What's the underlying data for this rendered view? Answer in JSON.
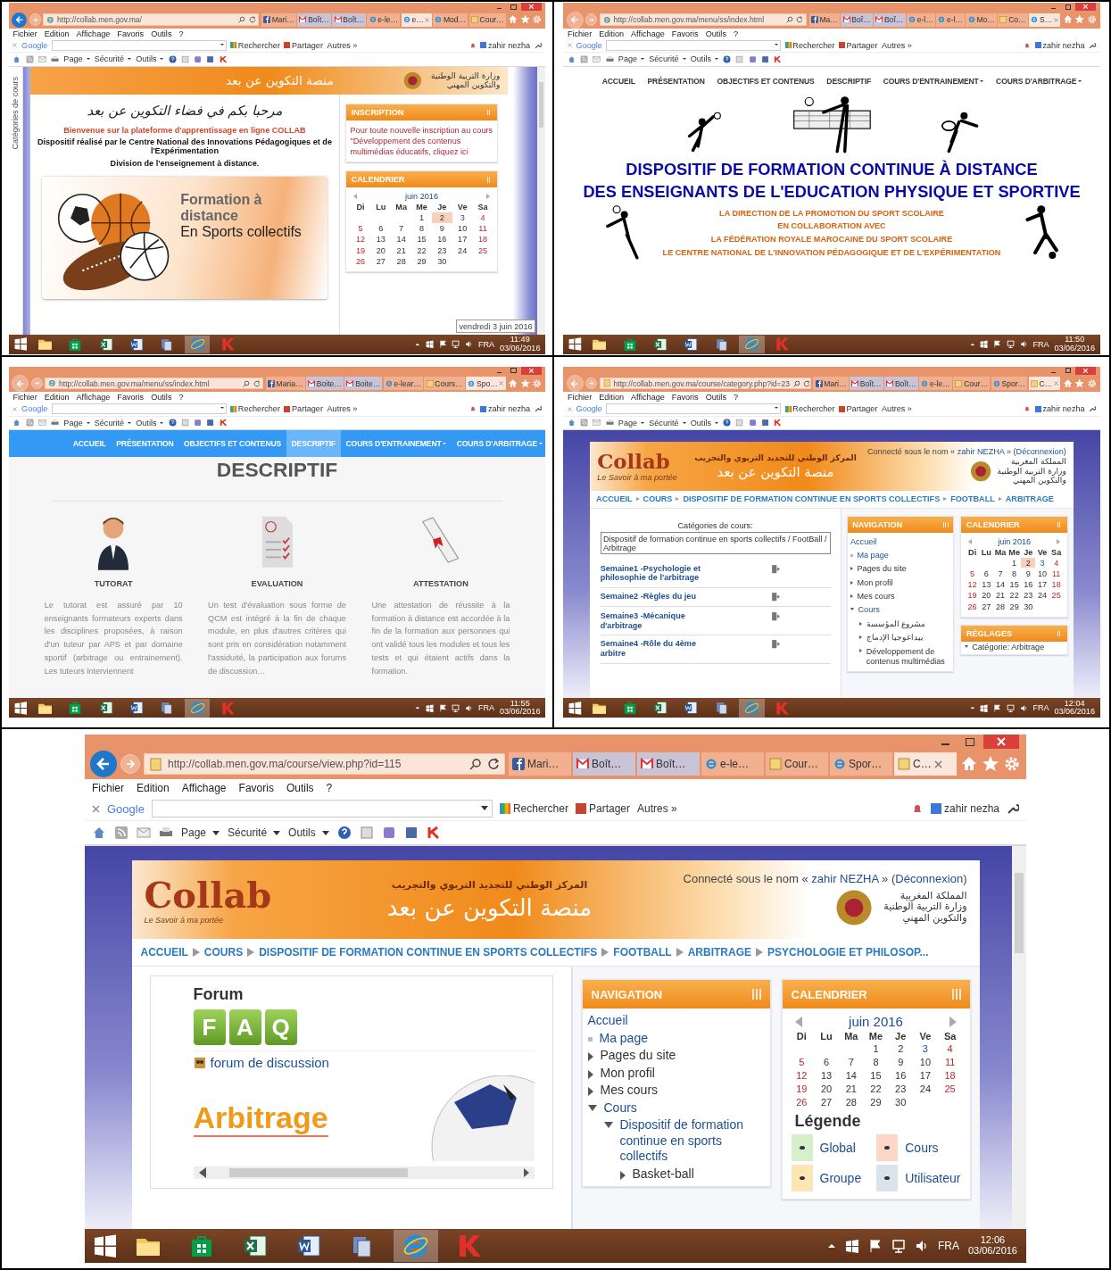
{
  "panels": [
    {
      "browser": {
        "back_enabled": true,
        "url": "http://collab.men.gov.ma/",
        "tabs": [
          {
            "label": "Mari…",
            "kind": "facebook",
            "selected": false
          },
          {
            "label": "Boît…",
            "kind": "mail",
            "selected": false
          },
          {
            "label": "Boît…",
            "kind": "mail",
            "selected": false
          },
          {
            "label": "e-le…",
            "kind": "browser",
            "selected": false
          },
          {
            "label": "e…",
            "kind": "browser",
            "selected": true
          },
          {
            "label": "Mod…",
            "kind": "browser",
            "selected": false
          },
          {
            "label": "Cour…",
            "kind": "course",
            "selected": false
          }
        ],
        "menu": [
          "Fichier",
          "Edition",
          "Affichage",
          "Favoris",
          "Outils",
          "?"
        ],
        "google_bar": {
          "brand": "Google",
          "search": "Rechercher",
          "share": "Partager",
          "more": "Autres »",
          "user": "zahir nezha"
        },
        "commands": [
          "Page",
          "Sécurité",
          "Outils"
        ]
      },
      "content": {
        "kind": "welcome",
        "header": {
          "title_ar": "منصة التكوين عن بعد",
          "ministry_ar": [
            "وزارة التربية الوطنية",
            "والتكوين المهني"
          ]
        },
        "side_tab": "Catégories de cours",
        "welcome_ar": "مرحبا بكم في فضاء التكوين عن بعد",
        "welcome_fr": "Bienvenue sur la plateforme d'apprentissage en ligne COLLAB",
        "credits": [
          "Dispositif réalisé par le Centre National des Innovations Pédagogiques et de l'Expérimentation",
          "Division de l'enseignement à distance."
        ],
        "banner": [
          "Formation à distance",
          "En Sports collectifs"
        ],
        "side_columns": [
          [
            {
              "kind": "text",
              "title": "INSCRIPTION",
              "text": "Pour toute nouvelle inscription au cours \"Développement des contenus multimédias éducatifs, cliquez ici"
            },
            {
              "kind": "calendar",
              "title": "CALENDRIER",
              "month": "juin 2016",
              "weekdays": [
                "Di",
                "Lu",
                "Ma",
                "Me",
                "Je",
                "Ve",
                "Sa"
              ],
              "weeks": [
                [
                  {
                    "kind": "blank"
                  },
                  {
                    "kind": "blank"
                  },
                  {
                    "kind": "blank"
                  },
                  {
                    "kind": "day",
                    "day": "1"
                  },
                  {
                    "kind": "today",
                    "day": "2"
                  },
                  {
                    "kind": "event",
                    "day": "3"
                  },
                  {
                    "kind": "day",
                    "day": "4"
                  }
                ],
                [
                  {
                    "kind": "day",
                    "day": "5"
                  },
                  {
                    "kind": "day",
                    "day": "6"
                  },
                  {
                    "kind": "day",
                    "day": "7"
                  },
                  {
                    "kind": "day",
                    "day": "8"
                  },
                  {
                    "kind": "day",
                    "day": "9"
                  },
                  {
                    "kind": "day",
                    "day": "10"
                  },
                  {
                    "kind": "day",
                    "day": "11"
                  }
                ],
                [
                  {
                    "kind": "day",
                    "day": "12"
                  },
                  {
                    "kind": "day",
                    "day": "13"
                  },
                  {
                    "kind": "day",
                    "day": "14"
                  },
                  {
                    "kind": "day",
                    "day": "15"
                  },
                  {
                    "kind": "day",
                    "day": "16"
                  },
                  {
                    "kind": "day",
                    "day": "17"
                  },
                  {
                    "kind": "day",
                    "day": "18"
                  }
                ],
                [
                  {
                    "kind": "day",
                    "day": "19"
                  },
                  {
                    "kind": "day",
                    "day": "20"
                  },
                  {
                    "kind": "day",
                    "day": "21"
                  },
                  {
                    "kind": "day",
                    "day": "22"
                  },
                  {
                    "kind": "day",
                    "day": "23"
                  },
                  {
                    "kind": "day",
                    "day": "24"
                  },
                  {
                    "kind": "day",
                    "day": "25"
                  }
                ],
                [
                  {
                    "kind": "day",
                    "day": "26"
                  },
                  {
                    "kind": "day",
                    "day": "27"
                  },
                  {
                    "kind": "day",
                    "day": "28"
                  },
                  {
                    "kind": "day",
                    "day": "29"
                  },
                  {
                    "kind": "day",
                    "day": "30"
                  }
                ]
              ]
            }
          ]
        ],
        "tooltip": "vendredi 3 juin 2016"
      },
      "taskbar": {
        "apps": [
          {
            "kind": "folder",
            "active": false
          },
          {
            "kind": "store",
            "active": false
          },
          {
            "kind": "sheet",
            "active": false
          },
          {
            "kind": "document",
            "active": false
          },
          {
            "kind": "files",
            "active": false
          },
          {
            "kind": "browser",
            "active": true
          },
          {
            "kind": "shield",
            "active": false
          }
        ],
        "lang": "FRA",
        "time": "11:49",
        "date": "03/06/2016"
      }
    },
    {
      "browser": {
        "back_enabled": false,
        "url": "http://collab.men.gov.ma/menu/ss/index.html",
        "tabs": [
          {
            "label": "Ma…",
            "kind": "facebook",
            "selected": false
          },
          {
            "label": "Boî…",
            "kind": "mail",
            "selected": false
          },
          {
            "label": "Boî…",
            "kind": "mail",
            "selected": false
          },
          {
            "label": "e-l…",
            "kind": "browser",
            "selected": false
          },
          {
            "label": "e-l…",
            "kind": "browser",
            "selected": false
          },
          {
            "label": "Mo…",
            "kind": "browser",
            "selected": false
          },
          {
            "label": "Co…",
            "kind": "course",
            "selected": false
          },
          {
            "label": "S…",
            "kind": "browser",
            "selected": true
          }
        ],
        "menu": [
          "Fichier",
          "Edition",
          "Affichage",
          "Favoris",
          "Outils",
          "?"
        ],
        "google_bar": {
          "brand": "Google",
          "search": "Rechercher",
          "share": "Partager",
          "more": "Autres »",
          "user": "zahir nezha"
        },
        "commands": [
          "Page",
          "Sécurité",
          "Outils"
        ]
      },
      "content": {
        "kind": "sports_home",
        "nav": [
          {
            "label": "ACCUEIL",
            "dropdown": false,
            "selected": false
          },
          {
            "label": "PRÉSENTATION",
            "dropdown": false,
            "selected": false
          },
          {
            "label": "OBJECTIFS ET CONTENUS",
            "dropdown": false,
            "selected": false
          },
          {
            "label": "DESCRIPTIF",
            "dropdown": false,
            "selected": false
          },
          {
            "label": "COURS D'ENTRAINEMENT",
            "dropdown": true,
            "selected": false
          },
          {
            "label": "COURS D'ARBITRAGE",
            "dropdown": true,
            "selected": false
          }
        ],
        "titles": [
          "DISPOSITIF DE FORMATION CONTINUE À DISTANCE",
          "DES ENSEIGNANTS DE L'EDUCATION PHYSIQUE ET SPORTIVE"
        ],
        "partners": [
          "LA DIRECTION DE LA PROMOTION DU SPORT SCOLAIRE",
          "EN COLLABORATION AVEC",
          "LA FÉDÉRATION ROYALE MAROCAINE DU SPORT SCOLAIRE",
          "LE CENTRE NATIONAL DE L'INNOVATION PÉDAGOGIQUE ET DE L'EXPÉRIMENTATION"
        ]
      },
      "taskbar": {
        "apps": [
          {
            "kind": "folder",
            "active": false
          },
          {
            "kind": "store",
            "active": false
          },
          {
            "kind": "sheet",
            "active": false
          },
          {
            "kind": "document",
            "active": false
          },
          {
            "kind": "files",
            "active": false
          },
          {
            "kind": "browser",
            "active": true
          },
          {
            "kind": "shield",
            "active": false
          }
        ],
        "lang": "FRA",
        "time": "11:50",
        "date": "03/06/2016"
      }
    },
    {
      "browser": {
        "back_enabled": false,
        "url": "http://collab.men.gov.ma/menu/ss/index.html",
        "tabs": [
          {
            "label": "Maria…",
            "kind": "facebook",
            "selected": false
          },
          {
            "label": "Boite…",
            "kind": "mail",
            "selected": false
          },
          {
            "label": "Boite…",
            "kind": "mail",
            "selected": false
          },
          {
            "label": "e-lear…",
            "kind": "browser",
            "selected": false
          },
          {
            "label": "Cours…",
            "kind": "course",
            "selected": false
          },
          {
            "label": "Spo…",
            "kind": "browser",
            "selected": true
          }
        ],
        "menu": [
          "Fichier",
          "Edition",
          "Affichage",
          "Favoris",
          "Outils",
          "?"
        ],
        "google_bar": {
          "brand": "Google",
          "search": "Rechercher",
          "share": "Partager",
          "more": "Autres »",
          "user": "zahir nezha"
        },
        "commands": [
          "Page",
          "Sécurité",
          "Outils"
        ]
      },
      "content": {
        "kind": "descriptif",
        "nav": [
          {
            "label": "ACCUEIL",
            "dropdown": false,
            "selected": false
          },
          {
            "label": "PRÉSENTATION",
            "dropdown": false,
            "selected": false
          },
          {
            "label": "OBJECTIFS ET CONTENUS",
            "dropdown": false,
            "selected": false
          },
          {
            "label": "DESCRIPTIF",
            "dropdown": false,
            "selected": true
          },
          {
            "label": "COURS D'ENTRAINEMENT",
            "dropdown": true,
            "selected": false
          },
          {
            "label": "COURS D'ARBITRAGE",
            "dropdown": true,
            "selected": false
          }
        ],
        "heading": "DESCRIPTIF",
        "features": [
          {
            "kind": "person",
            "title": "TUTORAT",
            "text": "Le tutorat est assuré par 10 enseignants formateurs experts dans les disciplines proposées, à raison d'un tuteur par APS et par domaine sportif (arbitrage ou entrainement). Les tuteurs interviennent"
          },
          {
            "kind": "checklist",
            "title": "EVALUATION",
            "text": "Un test d'évaluation sous forme de QCM est intégré à la fin de chaque module, en plus d'autres critères qui sont pris en considération notamment l'assiduité, la participation aux forums de discussion…"
          },
          {
            "kind": "diploma",
            "title": "ATTESTATION",
            "text": "Une attestation de réussite à la formation à distance est accordée à la fin de la formation aux personnes qui ont validé tous les modules et tous les tests et qui étaient actifs dans la formation."
          }
        ]
      },
      "taskbar": {
        "apps": [
          {
            "kind": "folder",
            "active": false
          },
          {
            "kind": "store",
            "active": false
          },
          {
            "kind": "sheet",
            "active": false
          },
          {
            "kind": "document",
            "active": false
          },
          {
            "kind": "files",
            "active": false
          },
          {
            "kind": "browser",
            "active": true
          },
          {
            "kind": "shield",
            "active": false
          }
        ],
        "lang": "FRA",
        "time": "11:55",
        "date": "03/06/2016"
      }
    },
    {
      "browser": {
        "back_enabled": false,
        "url": "http://collab.men.gov.ma/course/category.php?id=23",
        "tabs": [
          {
            "label": "Mari…",
            "kind": "facebook",
            "selected": false
          },
          {
            "label": "Boît…",
            "kind": "mail",
            "selected": false
          },
          {
            "label": "Boît…",
            "kind": "mail",
            "selected": false
          },
          {
            "label": "e-le…",
            "kind": "browser",
            "selected": false
          },
          {
            "label": "Cour…",
            "kind": "course",
            "selected": false
          },
          {
            "label": "Spor…",
            "kind": "browser",
            "selected": false
          },
          {
            "label": "C…",
            "kind": "course",
            "selected": true
          }
        ],
        "menu": [
          "Fichier",
          "Edition",
          "Affichage",
          "Favoris",
          "Outils",
          "?"
        ],
        "google_bar": {
          "brand": "Google",
          "search": "Rechercher",
          "share": "Partager",
          "more": "Autres »",
          "user": "zahir nezha"
        },
        "commands": [
          "Page",
          "Sécurité",
          "Outils"
        ]
      },
      "content": {
        "kind": "category",
        "header": {
          "logo": "Collab",
          "slogan": "Le Savoir à ma portée",
          "centre_ar": "المركز الوطني للتجديد التربوي والتجريب",
          "title_ar": "منصة التكوين عن بعد",
          "ministry_ar": [
            "المملكة المغربية",
            "وزارة التربية الوطنية",
            "والتكوين المهني"
          ],
          "login": {
            "prefix": "Connecté sous le nom «",
            "user": "zahir NEZHA",
            "middle": "» (",
            "logout": "Déconnexion",
            "suffix": ")"
          }
        },
        "breadcrumb": [
          "ACCUEIL",
          "COURS",
          "DISPOSITIF DE FORMATION CONTINUE EN SPORTS COLLECTIFS",
          "FOOTBALL",
          "ARBITRAGE"
        ],
        "categories_label": "Catégories de cours:",
        "category_value": "Dispositif de formation continue en sports collectifs / FootBall / Arbitrage",
        "weeks": [
          "Semaine1 -Psychologie et philosophie de l'arbitrage",
          "Semaine2 -Règles du jeu",
          "Semaine3 -Mécanique d'arbitrage",
          "Semaine4 -Rôle du 4ème arbitre"
        ],
        "side_columns": [
          [
            {
              "kind": "navigation",
              "title": "NAVIGATION",
              "tree": [
                {
                  "label": "Accueil",
                  "kind": "home"
                },
                {
                  "label": "Ma page",
                  "kind": "page"
                },
                {
                  "label": "Pages du site",
                  "kind": "branch",
                  "expanded": false
                },
                {
                  "label": "Mon profil",
                  "kind": "branch",
                  "expanded": false
                },
                {
                  "label": "Mes cours",
                  "kind": "branch",
                  "expanded": false
                },
                {
                  "label": "Cours",
                  "kind": "branch",
                  "expanded": true,
                  "children": [
                    {
                      "label": "مشروع المؤسسة",
                      "kind": "branch",
                      "expanded": false
                    },
                    {
                      "label": "بيداغوجيا الإدماج",
                      "kind": "branch",
                      "expanded": false
                    },
                    {
                      "label": "Développement de contenus multimédias",
                      "kind": "branch",
                      "expanded": false
                    }
                  ]
                }
              ]
            }
          ],
          [
            {
              "kind": "calendar",
              "title": "CALENDRIER",
              "month": "juin 2016",
              "weekdays": [
                "Di",
                "Lu",
                "Ma",
                "Me",
                "Je",
                "Ve",
                "Sa"
              ],
              "weeks": [
                [
                  {
                    "kind": "blank"
                  },
                  {
                    "kind": "blank"
                  },
                  {
                    "kind": "blank"
                  },
                  {
                    "kind": "day",
                    "day": "1"
                  },
                  {
                    "kind": "today",
                    "day": "2"
                  },
                  {
                    "kind": "event",
                    "day": "3"
                  },
                  {
                    "kind": "day",
                    "day": "4"
                  }
                ],
                [
                  {
                    "kind": "day",
                    "day": "5"
                  },
                  {
                    "kind": "day",
                    "day": "6"
                  },
                  {
                    "kind": "day",
                    "day": "7"
                  },
                  {
                    "kind": "day",
                    "day": "8"
                  },
                  {
                    "kind": "day",
                    "day": "9"
                  },
                  {
                    "kind": "day",
                    "day": "10"
                  },
                  {
                    "kind": "day",
                    "day": "11"
                  }
                ],
                [
                  {
                    "kind": "day",
                    "day": "12"
                  },
                  {
                    "kind": "day",
                    "day": "13"
                  },
                  {
                    "kind": "day",
                    "day": "14"
                  },
                  {
                    "kind": "day",
                    "day": "15"
                  },
                  {
                    "kind": "day",
                    "day": "16"
                  },
                  {
                    "kind": "day",
                    "day": "17"
                  },
                  {
                    "kind": "day",
                    "day": "18"
                  }
                ],
                [
                  {
                    "kind": "day",
                    "day": "19"
                  },
                  {
                    "kind": "day",
                    "day": "20"
                  },
                  {
                    "kind": "day",
                    "day": "21"
                  },
                  {
                    "kind": "day",
                    "day": "22"
                  },
                  {
                    "kind": "day",
                    "day": "23"
                  },
                  {
                    "kind": "day",
                    "day": "24"
                  },
                  {
                    "kind": "day",
                    "day": "25"
                  }
                ],
                [
                  {
                    "kind": "day",
                    "day": "26"
                  },
                  {
                    "kind": "day",
                    "day": "27"
                  },
                  {
                    "kind": "day",
                    "day": "28"
                  },
                  {
                    "kind": "day",
                    "day": "29"
                  },
                  {
                    "kind": "day",
                    "day": "30"
                  }
                ]
              ]
            },
            {
              "kind": "settings",
              "title": "RÉGLAGES",
              "items": [
                {
                  "label": "Catégorie: Arbitrage",
                  "expanded": true
                }
              ]
            }
          ]
        ]
      },
      "taskbar": {
        "apps": [
          {
            "kind": "folder",
            "active": false
          },
          {
            "kind": "store",
            "active": false
          },
          {
            "kind": "sheet",
            "active": false
          },
          {
            "kind": "document",
            "active": false
          },
          {
            "kind": "files",
            "active": false
          },
          {
            "kind": "browser",
            "active": true
          },
          {
            "kind": "shield",
            "active": false
          }
        ],
        "lang": "FRA",
        "time": "12:04",
        "date": "03/06/2016"
      }
    },
    {
      "browser": {
        "back_enabled": true,
        "url": "http://collab.men.gov.ma/course/view.php?id=115",
        "tabs": [
          {
            "label": "Mari…",
            "kind": "facebook",
            "selected": false
          },
          {
            "label": "Boît…",
            "kind": "mail",
            "selected": false
          },
          {
            "label": "Boît…",
            "kind": "mail",
            "selected": false
          },
          {
            "label": "e-le…",
            "kind": "browser",
            "selected": false
          },
          {
            "label": "Cour…",
            "kind": "course",
            "selected": false
          },
          {
            "label": "Spor…",
            "kind": "browser",
            "selected": false
          },
          {
            "label": "C…",
            "kind": "course",
            "selected": true
          }
        ],
        "menu": [
          "Fichier",
          "Edition",
          "Affichage",
          "Favoris",
          "Outils",
          "?"
        ],
        "google_bar": {
          "brand": "Google",
          "search": "Rechercher",
          "share": "Partager",
          "more": "Autres »",
          "user": "zahir nezha"
        },
        "commands": [
          "Page",
          "Sécurité",
          "Outils"
        ]
      },
      "content": {
        "kind": "course",
        "header": {
          "logo": "Collab",
          "slogan": "Le Savoir à ma portée",
          "centre_ar": "المركز الوطني للتجديد التربوي والتجريب",
          "title_ar": "منصة التكوين عن بعد",
          "ministry_ar": [
            "المملكة المغربية",
            "وزارة التربية الوطنية",
            "والتكوين المهني"
          ],
          "login": {
            "prefix": "Connecté sous le nom «",
            "user": "zahir NEZHA",
            "middle": "» (",
            "logout": "Déconnexion",
            "suffix": ")"
          }
        },
        "breadcrumb": [
          "ACCUEIL",
          "COURS",
          "DISPOSITIF DE FORMATION CONTINUE EN SPORTS COLLECTIFS",
          "FOOTBALL",
          "ARBITRAGE",
          "PSYCHOLOGIE ET PHILOSOP..."
        ],
        "forum": {
          "title": "Forum",
          "faq": [
            "F",
            "A",
            "Q"
          ],
          "link": "forum de discussion",
          "banner": "Arbitrage"
        },
        "side_columns": [
          [
            {
              "kind": "navigation",
              "title": "NAVIGATION",
              "tree": [
                {
                  "label": "Accueil",
                  "kind": "home"
                },
                {
                  "label": "Ma page",
                  "kind": "page"
                },
                {
                  "label": "Pages du site",
                  "kind": "branch",
                  "expanded": false
                },
                {
                  "label": "Mon profil",
                  "kind": "branch",
                  "expanded": false
                },
                {
                  "label": "Mes cours",
                  "kind": "branch",
                  "expanded": false
                },
                {
                  "label": "Cours",
                  "kind": "branch",
                  "expanded": true,
                  "children": [
                    {
                      "label": "Dispositif de formation continue en sports collectifs",
                      "kind": "branch",
                      "expanded": true,
                      "children": [
                        {
                          "label": "Basket-ball",
                          "kind": "branch",
                          "expanded": false
                        }
                      ]
                    }
                  ]
                }
              ]
            }
          ],
          [
            {
              "kind": "calendar",
              "title": "CALENDRIER",
              "month": "juin 2016",
              "weekdays": [
                "Di",
                "Lu",
                "Ma",
                "Me",
                "Je",
                "Ve",
                "Sa"
              ],
              "weeks": [
                [
                  {
                    "kind": "blank"
                  },
                  {
                    "kind": "blank"
                  },
                  {
                    "kind": "blank"
                  },
                  {
                    "kind": "day",
                    "day": "1"
                  },
                  {
                    "kind": "day",
                    "day": "2"
                  },
                  {
                    "kind": "event",
                    "day": "3"
                  },
                  {
                    "kind": "day",
                    "day": "4"
                  }
                ],
                [
                  {
                    "kind": "day",
                    "day": "5"
                  },
                  {
                    "kind": "day",
                    "day": "6"
                  },
                  {
                    "kind": "day",
                    "day": "7"
                  },
                  {
                    "kind": "day",
                    "day": "8"
                  },
                  {
                    "kind": "day",
                    "day": "9"
                  },
                  {
                    "kind": "day",
                    "day": "10"
                  },
                  {
                    "kind": "day",
                    "day": "11"
                  }
                ],
                [
                  {
                    "kind": "day",
                    "day": "12"
                  },
                  {
                    "kind": "day",
                    "day": "13"
                  },
                  {
                    "kind": "day",
                    "day": "14"
                  },
                  {
                    "kind": "day",
                    "day": "15"
                  },
                  {
                    "kind": "day",
                    "day": "16"
                  },
                  {
                    "kind": "day",
                    "day": "17"
                  },
                  {
                    "kind": "day",
                    "day": "18"
                  }
                ],
                [
                  {
                    "kind": "day",
                    "day": "19"
                  },
                  {
                    "kind": "day",
                    "day": "20"
                  },
                  {
                    "kind": "day",
                    "day": "21"
                  },
                  {
                    "kind": "day",
                    "day": "22"
                  },
                  {
                    "kind": "day",
                    "day": "23"
                  },
                  {
                    "kind": "day",
                    "day": "24"
                  },
                  {
                    "kind": "day",
                    "day": "25"
                  }
                ],
                [
                  {
                    "kind": "day",
                    "day": "26"
                  },
                  {
                    "kind": "day",
                    "day": "27"
                  },
                  {
                    "kind": "day",
                    "day": "28"
                  },
                  {
                    "kind": "day",
                    "day": "29"
                  },
                  {
                    "kind": "day",
                    "day": "30"
                  }
                ]
              ],
              "legend_title": "Légende",
              "legend": [
                {
                  "label": "Global",
                  "color": "#d6f0cc"
                },
                {
                  "label": "Cours",
                  "color": "#fcd6c6"
                },
                {
                  "label": "Groupe",
                  "color": "#fde6b4"
                },
                {
                  "label": "Utilisateur",
                  "color": "#d9e3ec"
                }
              ]
            }
          ]
        ]
      },
      "taskbar": {
        "apps": [
          {
            "kind": "folder",
            "active": false
          },
          {
            "kind": "store",
            "active": false
          },
          {
            "kind": "sheet",
            "active": false
          },
          {
            "kind": "document",
            "active": false
          },
          {
            "kind": "files",
            "active": false
          },
          {
            "kind": "browser",
            "active": true
          },
          {
            "kind": "shield",
            "active": false
          }
        ],
        "lang": "FRA",
        "time": "12:06",
        "date": "03/06/2016"
      }
    }
  ]
}
